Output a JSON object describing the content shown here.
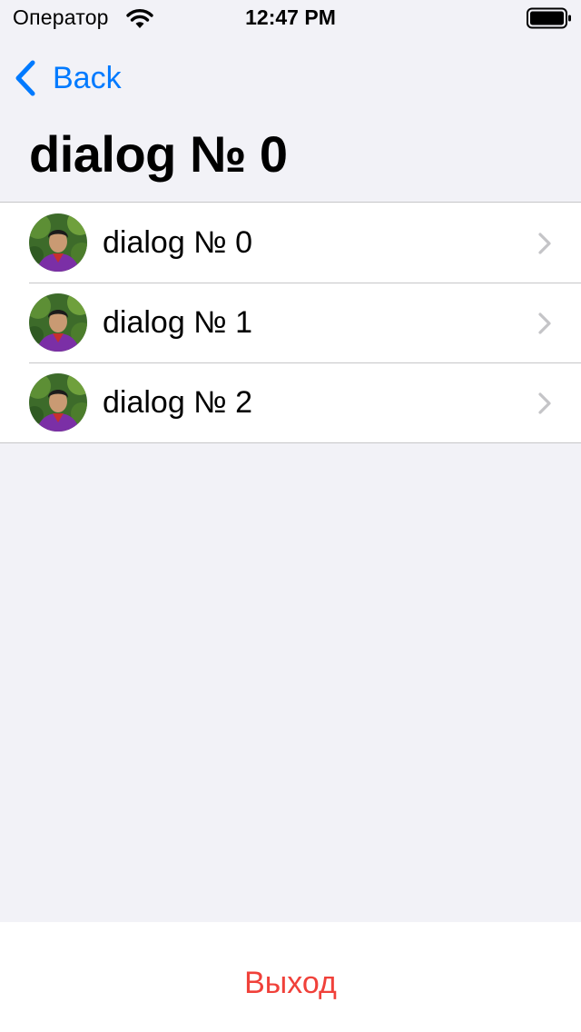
{
  "status_bar": {
    "carrier": "Оператор",
    "time": "12:47 PM",
    "wifi_icon": "wifi-icon",
    "battery_icon": "battery-full-icon"
  },
  "nav": {
    "back_label": "Back",
    "back_icon": "chevron-left-icon",
    "title": "dialog № 0"
  },
  "dialogs": {
    "items": [
      {
        "label": "dialog № 0",
        "avatar_icon": "avatar-photo",
        "chevron_icon": "chevron-right-icon"
      },
      {
        "label": "dialog № 1",
        "avatar_icon": "avatar-photo",
        "chevron_icon": "chevron-right-icon"
      },
      {
        "label": "dialog № 2",
        "avatar_icon": "avatar-photo",
        "chevron_icon": "chevron-right-icon"
      }
    ]
  },
  "footer": {
    "logout_label": "Выход"
  },
  "colors": {
    "accent": "#007aff",
    "destructive": "#f0413a",
    "background": "#f2f2f7",
    "separator": "#c6c6c8",
    "chevron": "#c4c4c7"
  }
}
